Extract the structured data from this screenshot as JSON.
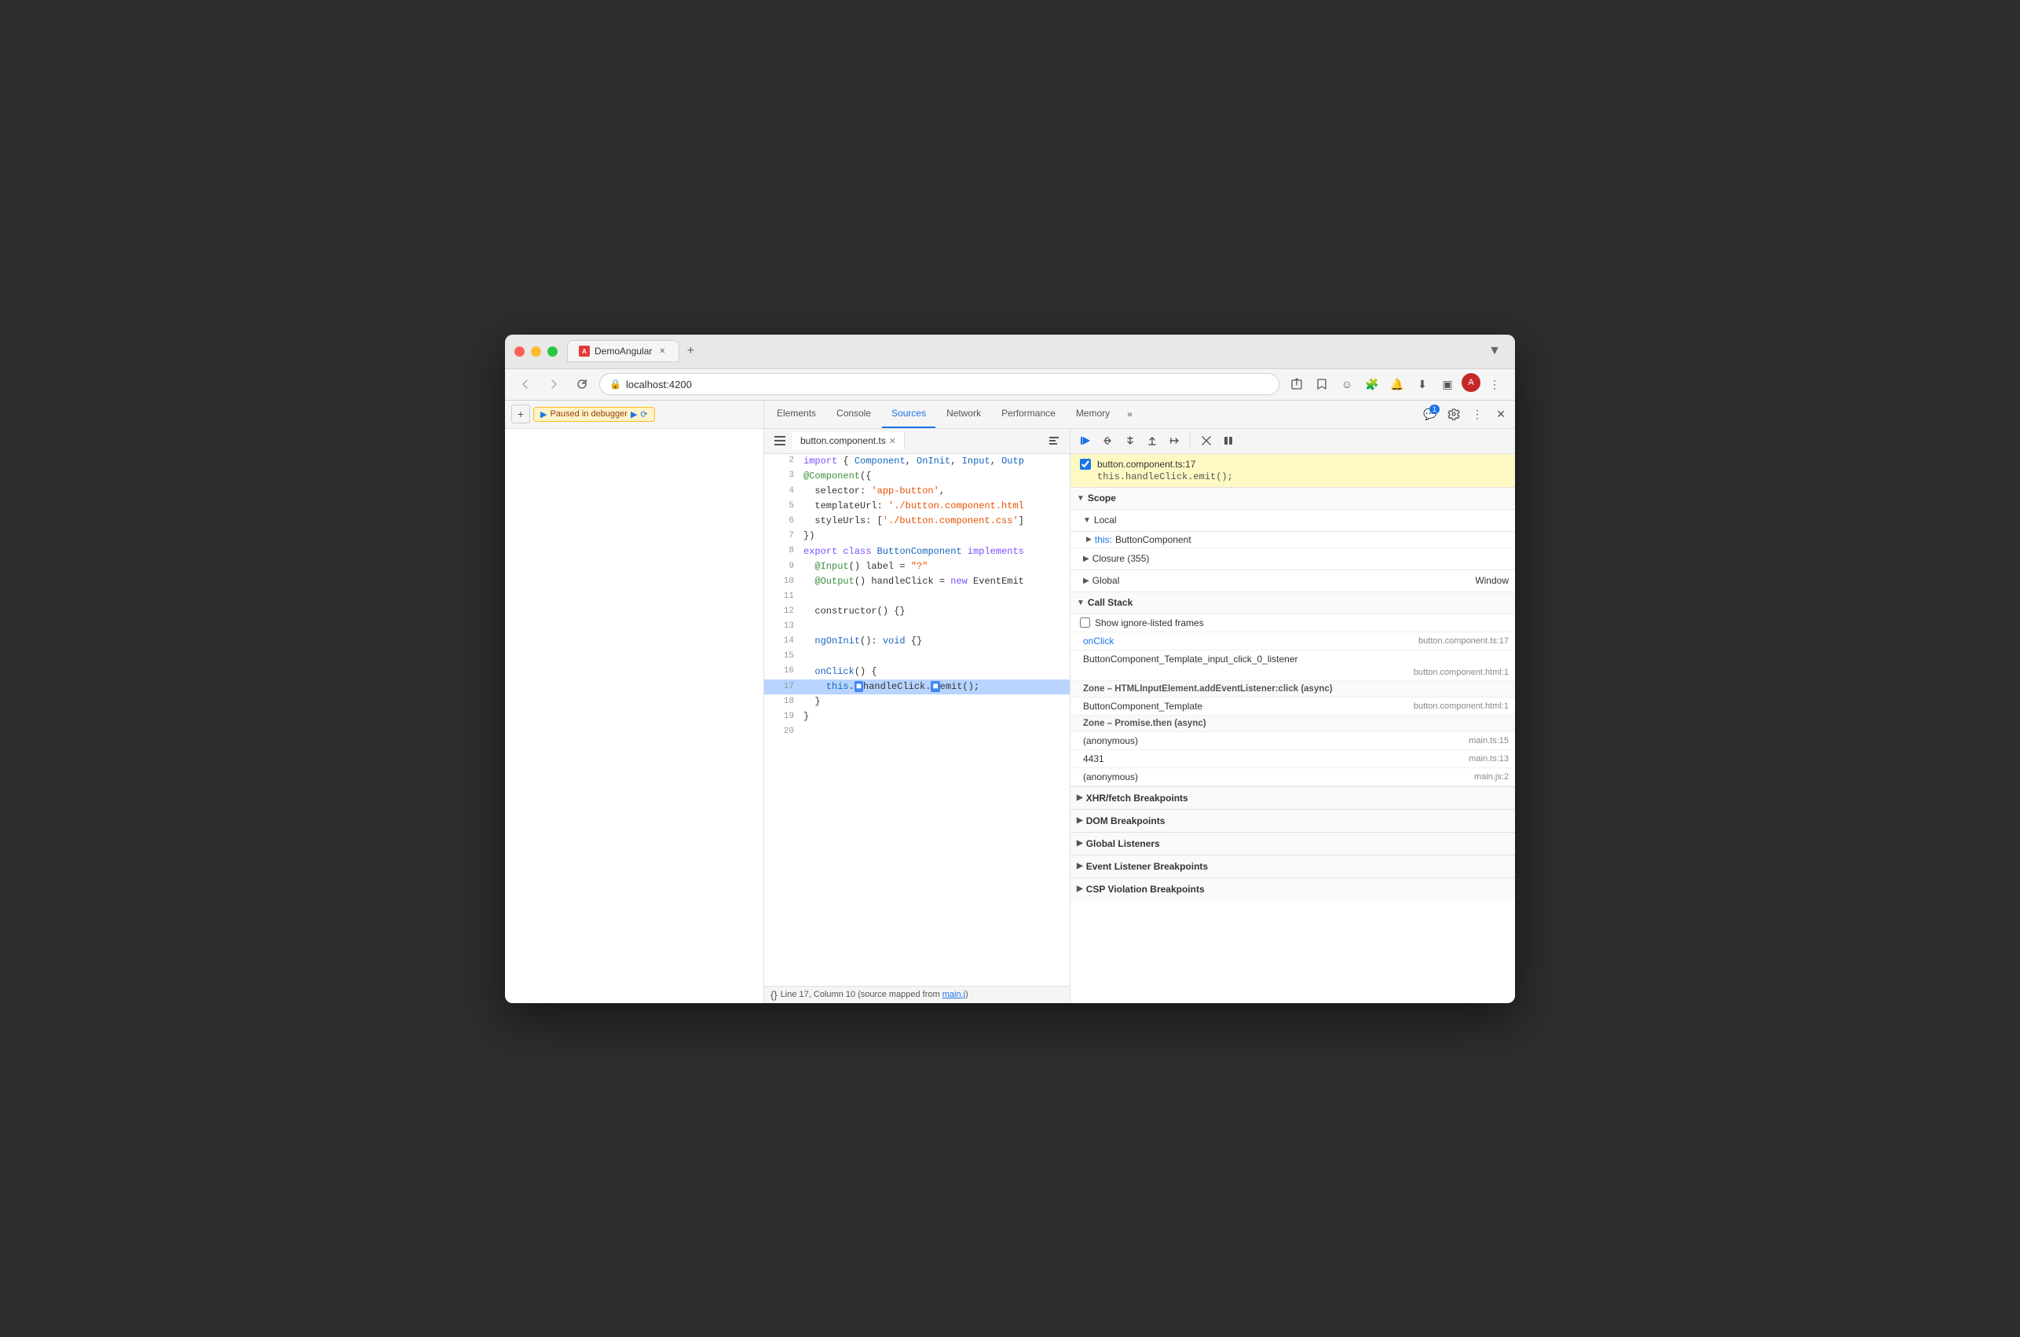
{
  "browser": {
    "tab_title": "DemoAngular",
    "tab_url": "localhost:4200",
    "tab_expand_label": "▼"
  },
  "nav": {
    "back_label": "←",
    "forward_label": "→",
    "reload_label": "↺",
    "url": "localhost:4200"
  },
  "page_panel": {
    "paused_label": "Paused in debugger",
    "add_btn_label": "+"
  },
  "devtools": {
    "tabs": [
      {
        "label": "Elements",
        "active": false
      },
      {
        "label": "Console",
        "active": false
      },
      {
        "label": "Sources",
        "active": true
      },
      {
        "label": "Network",
        "active": false
      },
      {
        "label": "Performance",
        "active": false
      },
      {
        "label": "Memory",
        "active": false
      }
    ],
    "more_label": "»",
    "notification_count": "1",
    "settings_label": "⚙",
    "more_actions_label": "⋮",
    "close_label": "✕"
  },
  "sources": {
    "file_tab_name": "button.component.ts",
    "code_lines": [
      {
        "num": "2",
        "text": "import { Component, OnInit, Input, Outp"
      },
      {
        "num": "3",
        "text": "@Component({"
      },
      {
        "num": "4",
        "text": "  selector: 'app-button',"
      },
      {
        "num": "5",
        "text": "  templateUrl: './button.component.html"
      },
      {
        "num": "6",
        "text": "  styleUrls: ['./button.component.css']"
      },
      {
        "num": "7",
        "text": "})"
      },
      {
        "num": "8",
        "text": "export class ButtonComponent implements"
      },
      {
        "num": "9",
        "text": "  @Input() label = \"?\""
      },
      {
        "num": "10",
        "text": "  @Output() handleClick = new EventEmit"
      },
      {
        "num": "11",
        "text": ""
      },
      {
        "num": "12",
        "text": "  constructor() {}"
      },
      {
        "num": "13",
        "text": ""
      },
      {
        "num": "14",
        "text": "  ngOnInit(): void {}"
      },
      {
        "num": "15",
        "text": ""
      },
      {
        "num": "16",
        "text": "  onClick() {"
      },
      {
        "num": "17",
        "text": "    this.handleClick.emit();",
        "highlighted": true
      },
      {
        "num": "18",
        "text": "  }"
      },
      {
        "num": "19",
        "text": "}"
      },
      {
        "num": "20",
        "text": ""
      }
    ],
    "status_line": "Line 17, Column 10 (source mapped from main.j"
  },
  "debugger": {
    "toolbar_buttons": [
      {
        "icon": "▶",
        "label": "resume",
        "active": true
      },
      {
        "icon": "↩",
        "label": "step-over"
      },
      {
        "icon": "↓",
        "label": "step-into"
      },
      {
        "icon": "↑",
        "label": "step-out"
      },
      {
        "icon": "⇥",
        "label": "step"
      },
      {
        "icon": "✎",
        "label": "deactivate"
      },
      {
        "icon": "⏸",
        "label": "pause-on-exceptions"
      }
    ],
    "breakpoint": {
      "file": "button.component.ts:17",
      "code": "this.handleClick.emit();"
    },
    "scope_label": "Scope",
    "local_label": "Local",
    "local_items": [
      {
        "key": "▶ this:",
        "val": "ButtonComponent"
      }
    ],
    "closure_label": "Closure (355)",
    "global_label": "Global",
    "global_val": "Window",
    "call_stack_label": "Call Stack",
    "show_ignore_label": "Show ignore-listed frames",
    "call_stack_items": [
      {
        "fn": "onClick",
        "file": "button.component.ts:17"
      },
      {
        "fn": "ButtonComponent_Template_input_click_0_listener",
        "file": "button.component.html:1"
      }
    ],
    "zone1_label": "Zone – HTMLInputElement.addEventListener:click (async)",
    "call_stack_items2": [
      {
        "fn": "ButtonComponent_Template",
        "file": "button.component.html:1"
      }
    ],
    "zone2_label": "Zone – Promise.then (async)",
    "call_stack_items3": [
      {
        "fn": "(anonymous)",
        "file": "main.ts:15"
      },
      {
        "fn": "4431",
        "file": "main.ts:13"
      },
      {
        "fn": "(anonymous)",
        "file": "main.js:2"
      }
    ],
    "xhr_breakpoints_label": "XHR/fetch Breakpoints",
    "dom_breakpoints_label": "DOM Breakpoints",
    "global_listeners_label": "Global Listeners",
    "event_listeners_label": "Event Listener Breakpoints",
    "csp_label": "CSP Violation Breakpoints"
  }
}
